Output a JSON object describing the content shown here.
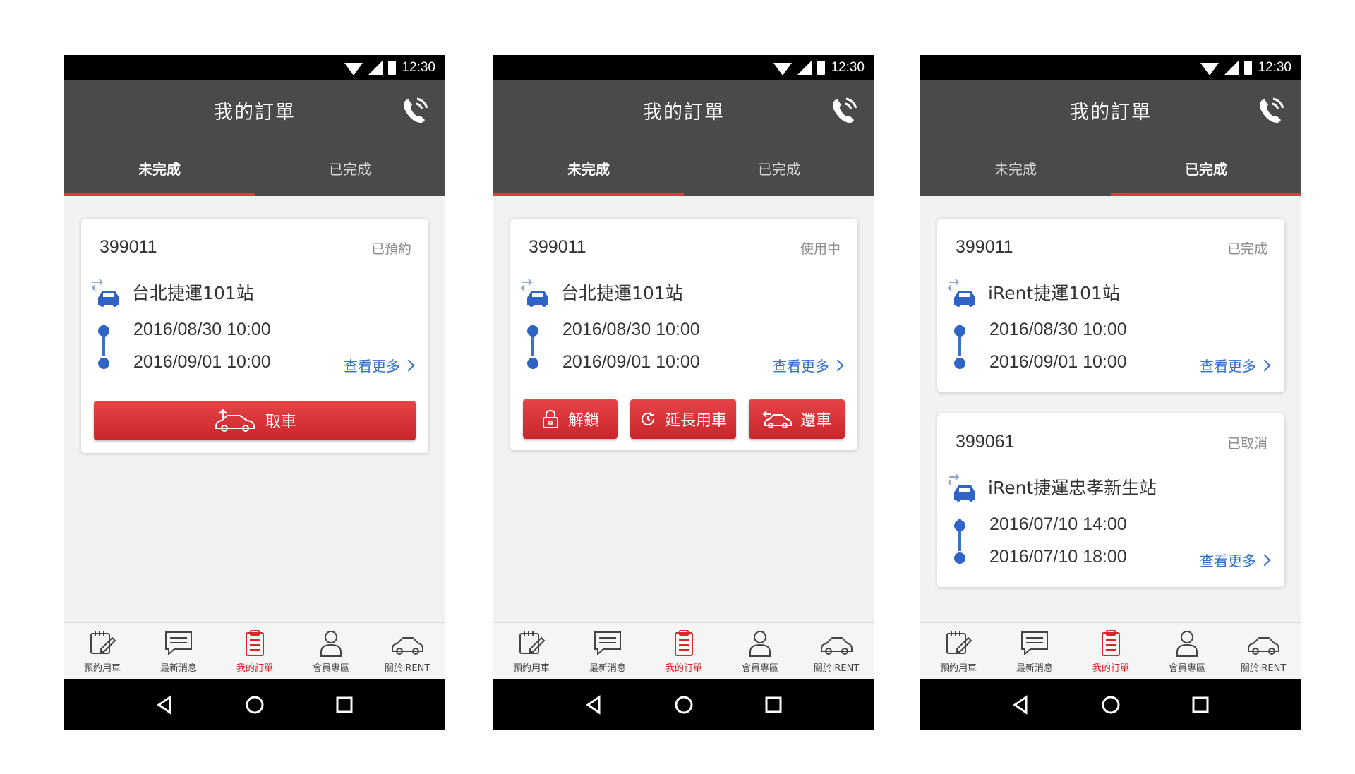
{
  "screens": [
    {
      "status_time": "12:30",
      "title": "我的訂單",
      "tabs": [
        {
          "label": "未完成",
          "active": true
        },
        {
          "label": "已完成",
          "active": false
        }
      ],
      "orders": [
        {
          "id": "399011",
          "status": "已預約",
          "station": "台北捷運101站",
          "start": "2016/08/30 10:00",
          "end": "2016/09/01 10:00",
          "more": "查看更多"
        }
      ],
      "actions": [
        {
          "label": "取車",
          "icon": "car-pickup-icon"
        }
      ]
    },
    {
      "status_time": "12:30",
      "title": "我的訂單",
      "tabs": [
        {
          "label": "未完成",
          "active": true
        },
        {
          "label": "已完成",
          "active": false
        }
      ],
      "orders": [
        {
          "id": "399011",
          "status": "使用中",
          "station": "台北捷運101站",
          "start": "2016/08/30 10:00",
          "end": "2016/09/01 10:00",
          "more": "查看更多"
        }
      ],
      "actions": [
        {
          "label": "解鎖",
          "icon": "unlock-icon"
        },
        {
          "label": "延長用車",
          "icon": "extend-timer-icon"
        },
        {
          "label": "還車",
          "icon": "car-return-icon"
        }
      ]
    },
    {
      "status_time": "12:30",
      "title": "我的訂單",
      "tabs": [
        {
          "label": "未完成",
          "active": false
        },
        {
          "label": "已完成",
          "active": true
        }
      ],
      "orders": [
        {
          "id": "399011",
          "status": "已完成",
          "station": "iRent捷運101站",
          "start": "2016/08/30 10:00",
          "end": "2016/09/01 10:00",
          "more": "查看更多"
        },
        {
          "id": "399061",
          "status": "已取消",
          "station": "iRent捷運忠孝新生站",
          "start": "2016/07/10 14:00",
          "end": "2016/07/10 18:00",
          "more": "查看更多"
        }
      ],
      "actions": []
    }
  ],
  "bottom_nav": [
    {
      "label": "預約用車",
      "icon": "booking-icon"
    },
    {
      "label": "最新消息",
      "icon": "message-icon"
    },
    {
      "label": "我的訂單",
      "icon": "clipboard-icon",
      "active": true
    },
    {
      "label": "會員專區",
      "icon": "user-icon"
    },
    {
      "label": "關於iRENT",
      "icon": "car-icon"
    }
  ],
  "colors": {
    "accent": "#e03a3e",
    "header": "#4a4a4c",
    "link": "#2f6fc9",
    "dot": "#2f63c6"
  }
}
